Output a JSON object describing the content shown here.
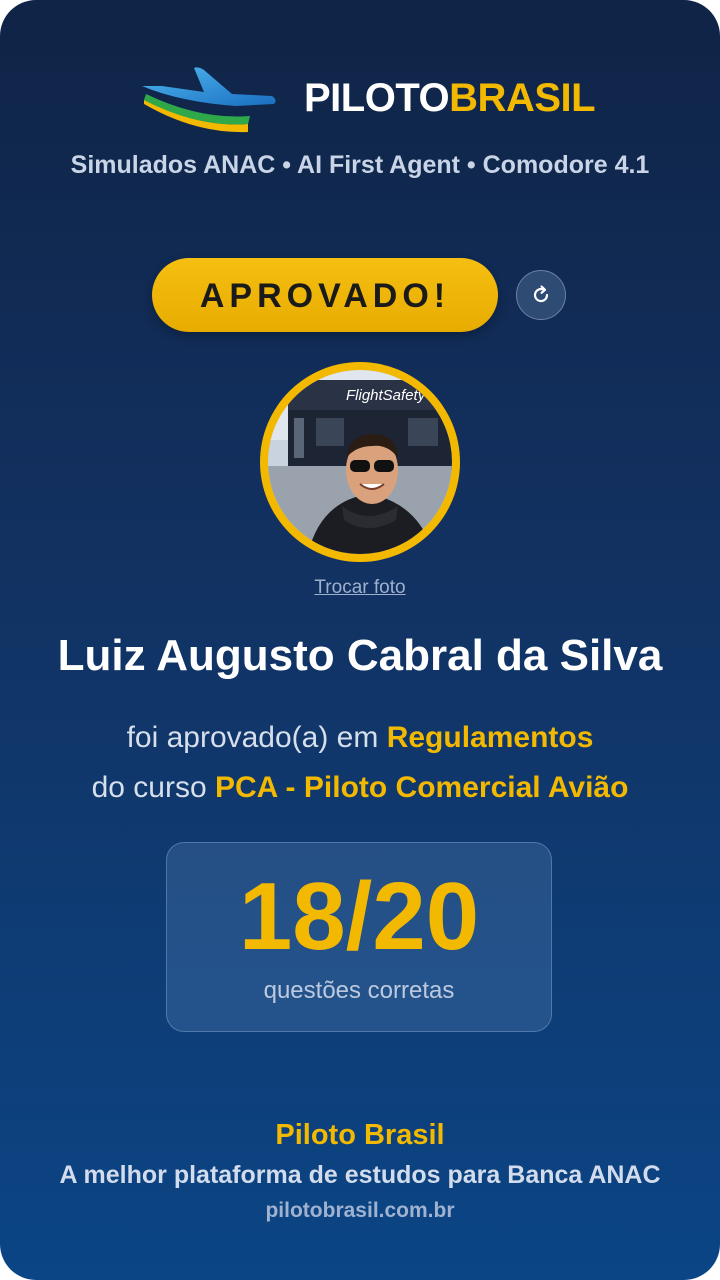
{
  "brand": {
    "part1": "PILOTO",
    "part2": "BRASIL",
    "logo_icon": "airplane-logo-icon"
  },
  "tagline": "Simulados ANAC • AI First Agent • Comodore 4.1",
  "status": {
    "label": "APROVADO!",
    "refresh_icon": "refresh-icon"
  },
  "avatar": {
    "sign_text": "FlightSafety",
    "change_photo_label": "Trocar foto"
  },
  "student": {
    "name": "Luiz Augusto Cabral da Silva"
  },
  "result": {
    "line1_prefix": "foi aprovado(a) em",
    "subject": "Regulamentos",
    "line2_prefix": "do curso",
    "course": "PCA - Piloto Comercial Avião"
  },
  "score": {
    "value": "18/20",
    "label": "questões corretas"
  },
  "footer": {
    "brand": "Piloto Brasil",
    "tagline": "A melhor plataforma de estudos para Banca ANAC",
    "url": "pilotobrasil.com.br"
  },
  "colors": {
    "accent": "#f2b900",
    "background_top": "#0f2446",
    "background_bottom": "#0b4585"
  }
}
